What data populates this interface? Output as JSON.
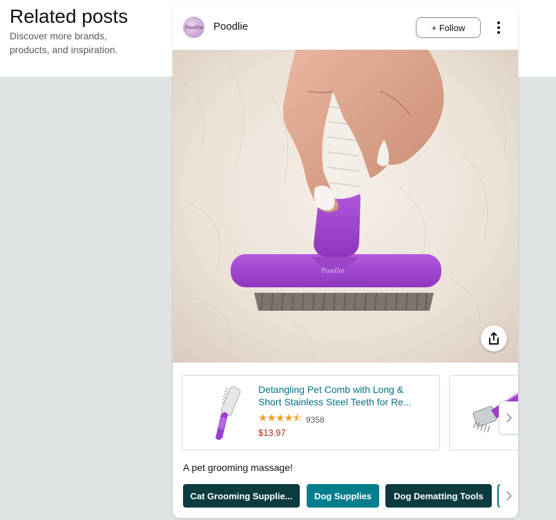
{
  "section": {
    "title": "Related posts",
    "subtitle": "Discover more brands, products, and inspiration."
  },
  "post": {
    "brand_name": "Poodlie",
    "avatar_text": "Poodlie",
    "follow_label": "+ Follow",
    "caption": "A pet grooming massage!",
    "image_description_icon": "grooming-brush-photo",
    "brush_imprint": "Poodlie"
  },
  "products": [
    {
      "title": "Detangling Pet Comb with Long & Short Stainless Steel Teeth for Re...",
      "stars": "★★★★⯪",
      "rating_value": 4.5,
      "rating_count": "9358",
      "price": "$13.97",
      "icon": "pet-comb-icon"
    },
    {
      "icon": "dematting-tool-icon"
    }
  ],
  "tags": [
    {
      "label": "Cat Grooming Supplie..."
    },
    {
      "label": "Dog Supplies"
    },
    {
      "label": "Dog Dematting Tools"
    },
    {
      "label": ""
    }
  ],
  "colors": {
    "link": "#007185",
    "price": "#b12704",
    "star": "#f29d1e",
    "tag_dark": "#0b3b3e",
    "tag_teal": "#007e8d",
    "page_bg": "#dfe3e4"
  }
}
